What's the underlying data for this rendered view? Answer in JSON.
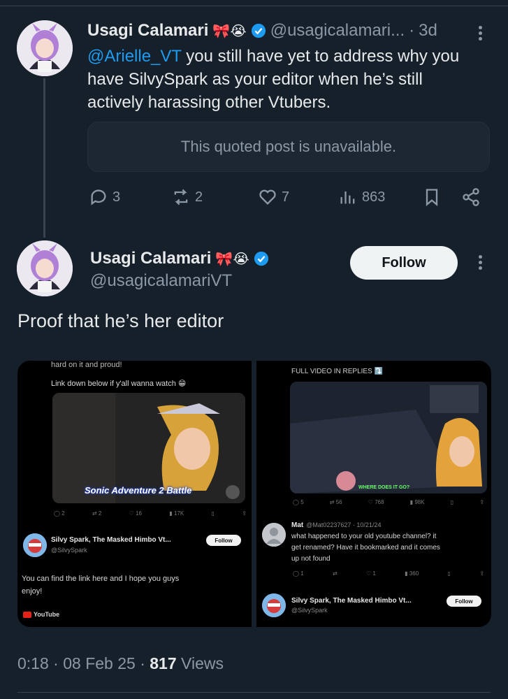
{
  "first_tweet": {
    "author_name": "Usagi Calamari",
    "name_emojis": "🎀😭",
    "handle": "@usagicalamari...",
    "time": "3d",
    "mention": "@Arielle_VT",
    "text_line1_rest": " you still have yet to address why you",
    "text_line2": "have SilvySpark as your editor when he’s still",
    "text_line3": "actively harassing other Vtubers.",
    "quoted_unavailable": "This quoted post is unavailable.",
    "actions": {
      "replies": "3",
      "reposts": "2",
      "likes": "7",
      "views": "863"
    }
  },
  "second_tweet": {
    "author_name": "Usagi Calamari",
    "name_emojis": "🎀😭",
    "handle": "@usagicalamariVT",
    "follow_label": "Follow",
    "text": "Proof that he’s her editor",
    "time": "0:18",
    "date": "08 Feb 25",
    "views_count": "817",
    "views_label": "Views"
  },
  "media_left": {
    "top_text": "hard on it and proud!",
    "link_text": "Link down below if y'all wanna watch 😁",
    "game_title": "Sonic Adventure 2 Battle",
    "actions": [
      "2",
      "2",
      "16",
      "17K"
    ],
    "reply_name": "Silvy Spark, The Masked Himbo Vt...",
    "reply_handle": "@SilvySpark",
    "follow_label": "Follow",
    "reply_text_1": "You can find the link here and I hope you guys",
    "reply_text_2": "enjoy!",
    "youtube_label": "YouTube"
  },
  "media_right": {
    "top_text": "FULL VIDEO IN REPLIES ⤵️",
    "overlay_text": "WHERE DOES IT GO?",
    "actions": [
      "5",
      "56",
      "768",
      "98K"
    ],
    "reply_name": "Mat",
    "reply_meta": "@Mat02237627 · 10/21/24",
    "reply_text_1": "what happened to your old youtube channel? it",
    "reply_text_2": "get renamed? Have it bookmarked and it comes",
    "reply_text_3": "up not found",
    "reply_actions": [
      "1",
      "",
      "1",
      "360"
    ],
    "second_name": "Silvy Spark, The Masked Himbo Vt...",
    "second_handle": "@SilvySpark",
    "follow_label": "Follow"
  },
  "colors": {
    "background": "#15202b",
    "accent": "#1d9bf0",
    "muted": "#8b98a5"
  }
}
